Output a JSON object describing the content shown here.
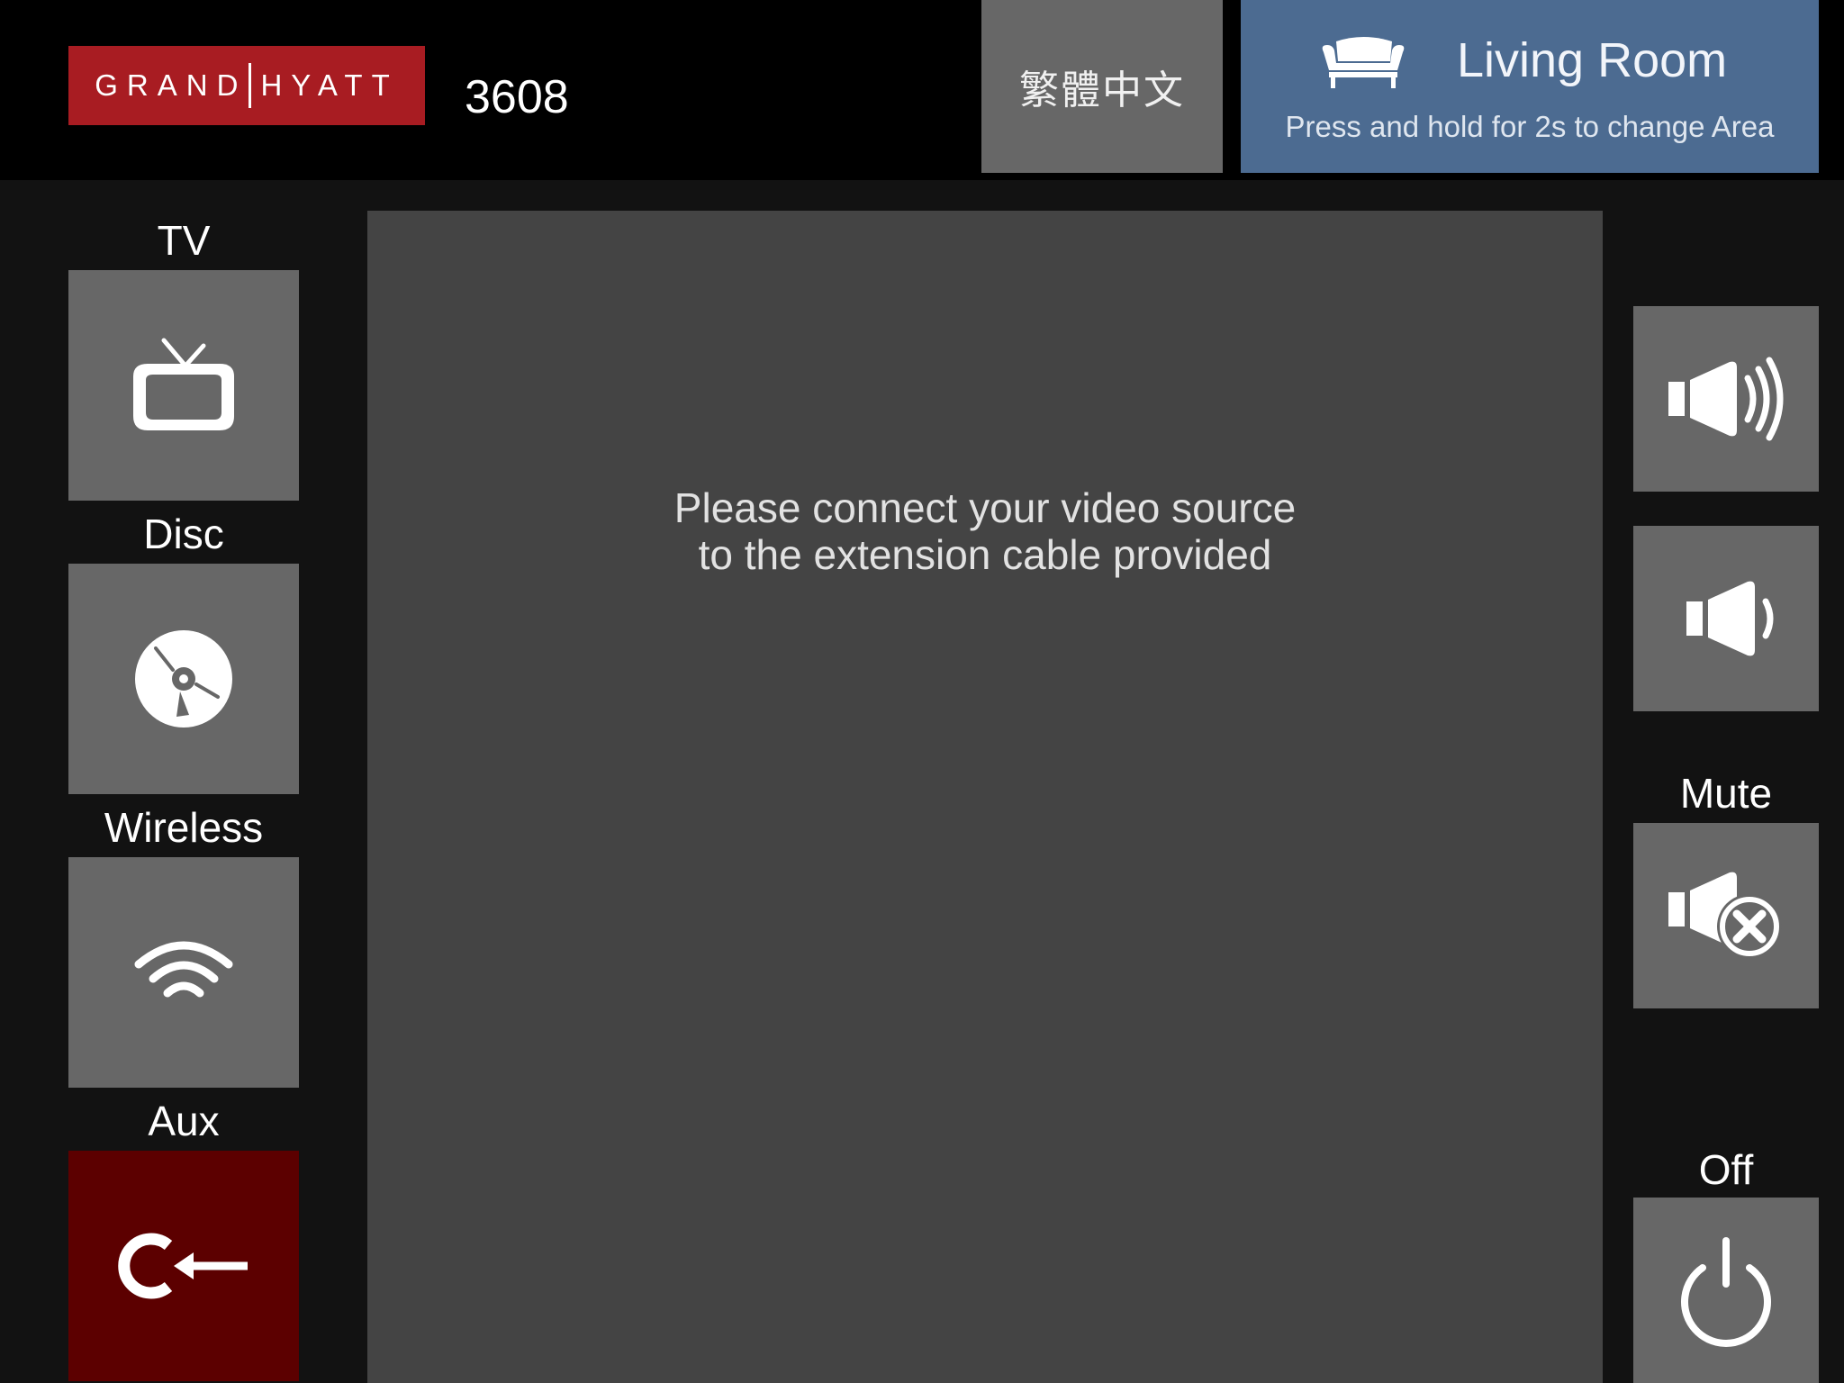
{
  "header": {
    "logo": {
      "left_word": "GRAND",
      "right_word": "HYATT"
    },
    "room_number": "3608",
    "language_button": "繁體中文",
    "area": {
      "icon": "sofa-icon",
      "title": "Living Room",
      "subtitle": "Press and hold for 2s to change Area"
    }
  },
  "sources": [
    {
      "label": "TV",
      "icon": "tv-icon",
      "active": false
    },
    {
      "label": "Disc",
      "icon": "disc-icon",
      "active": false
    },
    {
      "label": "Wireless",
      "icon": "wifi-icon",
      "active": false
    },
    {
      "label": "Aux",
      "icon": "aux-input-icon",
      "active": true
    }
  ],
  "main": {
    "message_line1": "Please connect your video source",
    "message_line2": "to the extension cable provided"
  },
  "volume": {
    "up_icon": "volume-up-icon",
    "down_icon": "volume-down-icon",
    "mute_label": "Mute",
    "mute_icon": "mute-icon"
  },
  "power": {
    "label": "Off",
    "icon": "power-icon"
  },
  "colors": {
    "brand_red": "#a81c22",
    "area_blue": "#4c6b91",
    "tile_gray": "#676767",
    "active_source": "#5c0000",
    "video_bg": "#444444"
  }
}
